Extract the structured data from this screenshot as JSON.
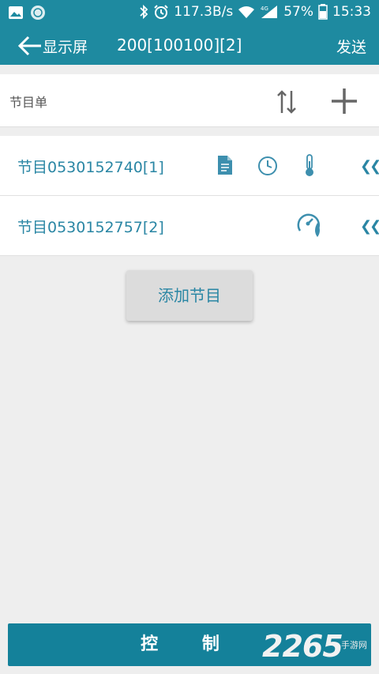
{
  "status_bar": {
    "network_speed": "117.3B/s",
    "battery": "57%",
    "time": "15:33",
    "icons": [
      "image-notify-icon",
      "app-notify-icon",
      "bluetooth-icon",
      "alarm-icon",
      "wifi-icon",
      "signal-4g-icon",
      "battery-icon"
    ]
  },
  "app_bar": {
    "back_label": "显示屏",
    "title": "200[100100][2]",
    "send_label": "发送"
  },
  "list_header": {
    "title": "节目单",
    "icons": [
      "sort-icon",
      "add-icon"
    ]
  },
  "programs": [
    {
      "label": "节目0530152740[1]",
      "icons": [
        "document-icon",
        "clock-icon",
        "thermometer-icon"
      ]
    },
    {
      "label": "节目0530152757[2]",
      "icons": [
        "gauge-humidity-icon"
      ]
    }
  ],
  "add_program_button": "添加节目",
  "control_button": "控 制",
  "watermark": {
    "main": "2265",
    "sub": "手游网"
  },
  "colors": {
    "primary": "#1e8aa0",
    "accent_text": "#2a86a4",
    "background": "#eeeeee"
  }
}
